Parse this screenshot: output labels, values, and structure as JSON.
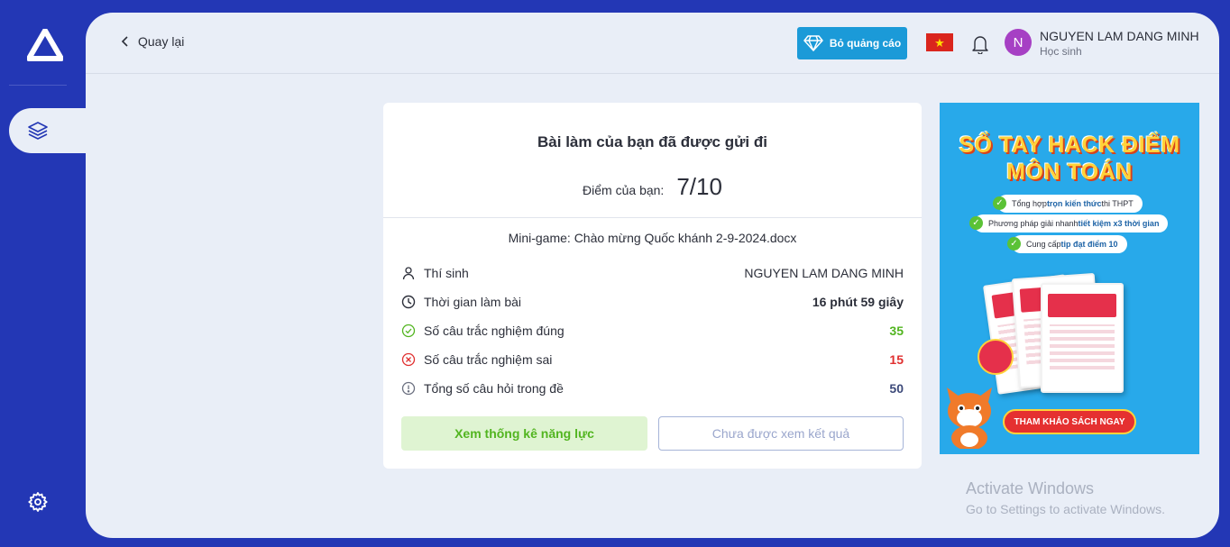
{
  "nav": {
    "back_label": "Quay lại"
  },
  "header": {
    "remove_ads_label": "Bỏ quảng cáo",
    "user_initial": "N",
    "user_name": "NGUYEN LAM DANG MINH",
    "user_role": "Học sinh"
  },
  "result": {
    "title": "Bài làm của bạn đã được gửi đi",
    "score_label": "Điểm của bạn:",
    "score_value": "7/10",
    "file_name": "Mini-game: Chào mừng Quốc khánh 2-9-2024.docx",
    "rows": [
      {
        "label": "Thí sinh",
        "value": "NGUYEN LAM DANG MINH"
      },
      {
        "label": "Thời gian làm bài",
        "value": "16 phút 59 giây"
      },
      {
        "label": "Số câu trắc nghiệm đúng",
        "value": "35"
      },
      {
        "label": "Số câu trắc nghiệm sai",
        "value": "15"
      },
      {
        "label": "Tổng số câu hỏi trong đề",
        "value": "50"
      }
    ],
    "stats_button": "Xem thống kê năng lực",
    "result_button": "Chưa được xem kết quả"
  },
  "banner": {
    "title_line1": "SỔ TAY HACK ĐIỂM",
    "title_line2": "MÔN TOÁN",
    "bullets": [
      {
        "pre": "Tổng hợp ",
        "bold": "trọn kiến thức",
        "post": " thi THPT"
      },
      {
        "pre": "Phương pháp giải nhanh ",
        "bold": "tiết kiệm x3 thời gian",
        "post": ""
      },
      {
        "pre": "Cung cấp ",
        "bold": "tip đạt điểm 10",
        "post": ""
      }
    ],
    "cta": "THAM KHẢO SÁCH NGAY"
  },
  "watermark": {
    "line1": "Activate Windows",
    "line2": "Go to Settings to activate Windows."
  },
  "colors": {
    "sidebar": "#2337b5",
    "panel": "#e9eef7",
    "accent_blue": "#1b9ad8",
    "correct": "#52b520",
    "wrong": "#e03030",
    "avatar": "#a640c4"
  },
  "icons": [
    "logo-icon",
    "layers-icon",
    "gear-icon",
    "chevron-left-icon",
    "diamond-icon",
    "vietnam-flag-icon",
    "bell-icon",
    "user-icon",
    "clock-icon",
    "check-circle-icon",
    "x-circle-icon",
    "info-circle-icon"
  ]
}
